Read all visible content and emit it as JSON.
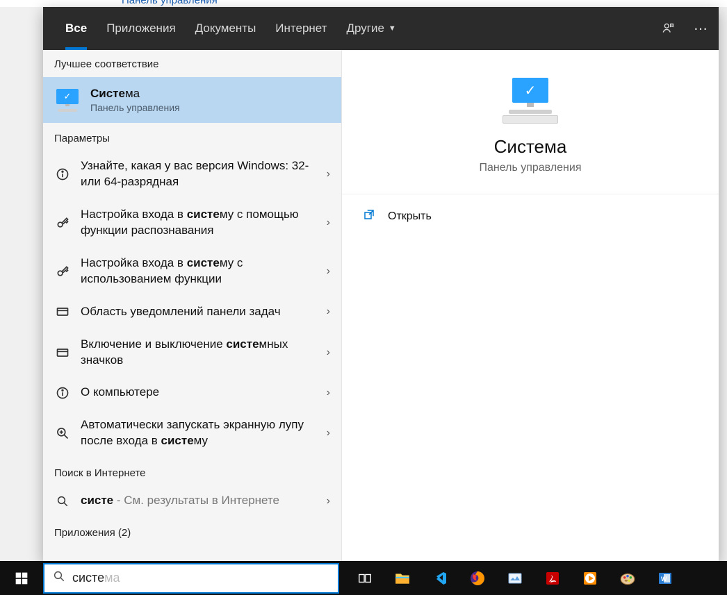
{
  "fragment_link": "Панель управления",
  "tabs": {
    "all": "Все",
    "apps": "Приложения",
    "docs": "Документы",
    "web": "Интернет",
    "more": "Другие"
  },
  "sections": {
    "best": "Лучшее соответствие",
    "settings": "Параметры",
    "websearch": "Поиск в Интернете",
    "apps_count": "Приложения (2)"
  },
  "best_match": {
    "title_bold": "Систе",
    "title_rest": "ма",
    "subtitle": "Панель управления"
  },
  "results": [
    {
      "icon": "info",
      "text": "Узнайте, какая у вас версия Windows: 32- или 64-разрядная"
    },
    {
      "icon": "key",
      "html": "Настройка входа в <b>систе</b>му с помощью функции распознавания"
    },
    {
      "icon": "key",
      "html": "Настройка входа в <b>систе</b>му с использованием функции"
    },
    {
      "icon": "panel",
      "text": "Область уведомлений панели задач"
    },
    {
      "icon": "panel",
      "html": "Включение и выключение <b>систе</b>мных значков"
    },
    {
      "icon": "info",
      "text": "О компьютере"
    },
    {
      "icon": "zoom",
      "html": "Автоматически запускать экранную лупу после входа в <b>систе</b>му"
    }
  ],
  "web_result": {
    "query": "систе",
    "hint": " - См. результаты в Интернете"
  },
  "preview": {
    "title": "Система",
    "subtitle": "Панель управления",
    "open": "Открыть"
  },
  "search": {
    "typed": "систе",
    "ghost": "ма"
  }
}
